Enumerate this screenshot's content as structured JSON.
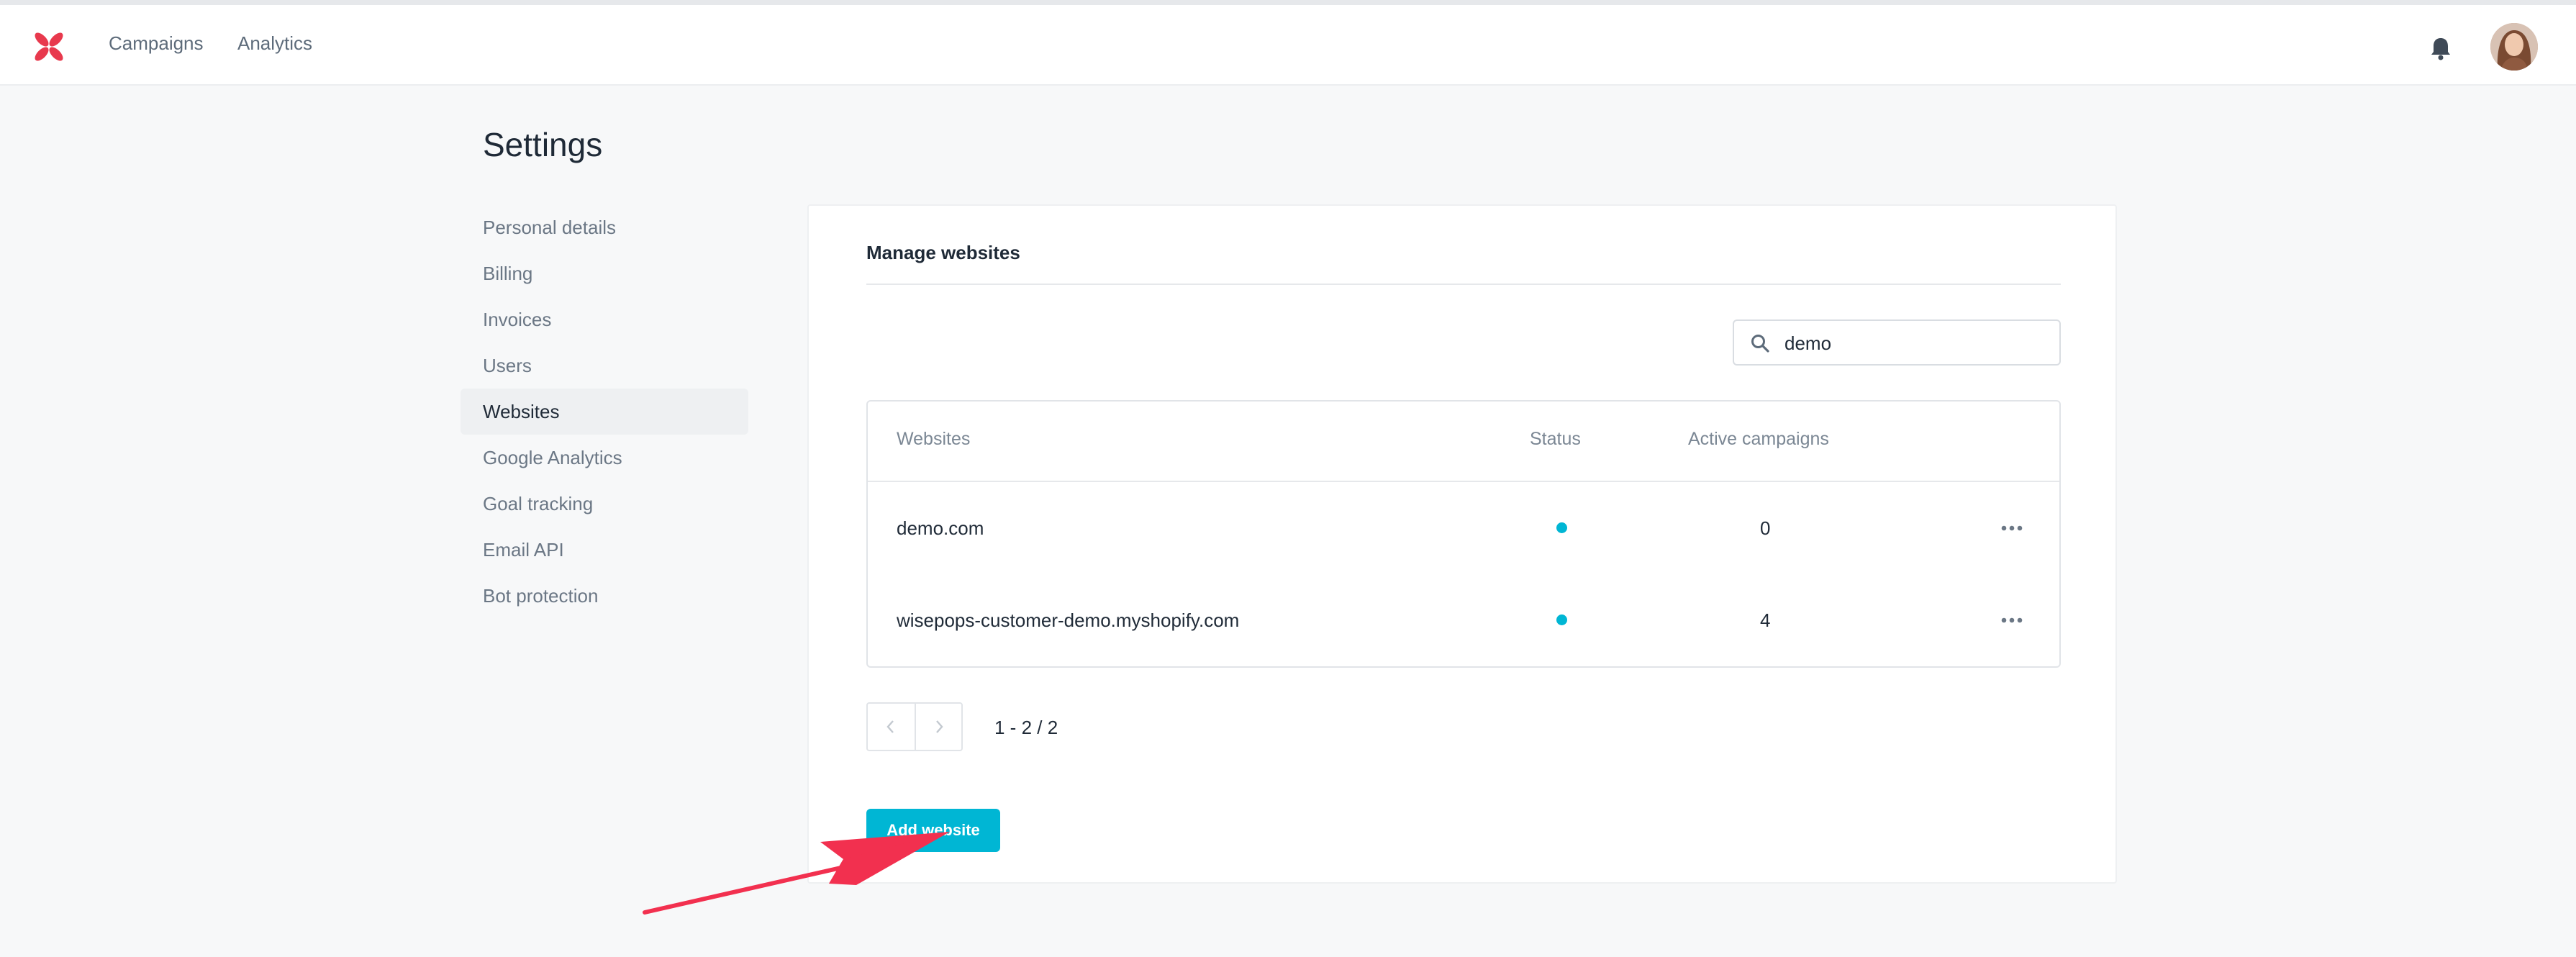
{
  "nav": {
    "links": [
      "Campaigns",
      "Analytics"
    ]
  },
  "page": {
    "title": "Settings"
  },
  "sidebar": {
    "items": [
      {
        "label": "Personal details"
      },
      {
        "label": "Billing"
      },
      {
        "label": "Invoices"
      },
      {
        "label": "Users"
      },
      {
        "label": "Websites",
        "active": true
      },
      {
        "label": "Google Analytics"
      },
      {
        "label": "Goal tracking"
      },
      {
        "label": "Email API"
      },
      {
        "label": "Bot protection"
      }
    ]
  },
  "card": {
    "title": "Manage websites",
    "search": {
      "value": "demo"
    },
    "table": {
      "headers": [
        "Websites",
        "Status",
        "Active campaigns"
      ],
      "rows": [
        {
          "website": "demo.com",
          "status": "active",
          "active_campaigns": "0"
        },
        {
          "website": "wisepops-customer-demo.myshopify.com",
          "status": "active",
          "active_campaigns": "4"
        }
      ]
    },
    "pagination": {
      "info": "1 - 2 / 2"
    },
    "add_button": "Add website"
  },
  "colors": {
    "accent": "#00b6d4",
    "logo": "#e8394d",
    "arrow": "#f2304f"
  },
  "icons": [
    "logo-icon",
    "bell-icon",
    "avatar",
    "search-icon",
    "more-icon",
    "chevron-left-icon",
    "chevron-right-icon"
  ]
}
